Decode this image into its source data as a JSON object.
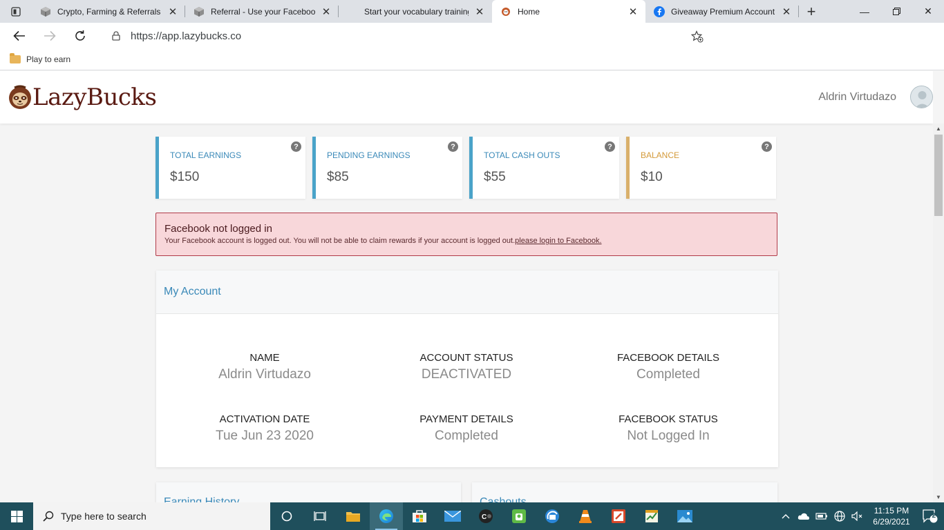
{
  "browser": {
    "tabs": [
      {
        "title": "Crypto, Farming & Referrals |",
        "icon": "box-icon"
      },
      {
        "title": "Referral - Use your Facebook",
        "icon": "box-icon"
      },
      {
        "title": "Start your vocabulary training",
        "icon": "blank-icon"
      },
      {
        "title": "Home",
        "icon": "lazybucks-icon"
      },
      {
        "title": "Giveaway Premium Account",
        "icon": "facebook-icon"
      }
    ],
    "url": "https://app.lazybucks.co",
    "bookmark_folder": "Play to earn"
  },
  "site": {
    "logo_text": "LazyBucks",
    "user_name": "Aldrin Virtudazo"
  },
  "stats": [
    {
      "label": "TOTAL EARNINGS",
      "value": "$150"
    },
    {
      "label": "PENDING EARNINGS",
      "value": "$85"
    },
    {
      "label": "TOTAL CASH OUTS",
      "value": "$55"
    },
    {
      "label": "BALANCE",
      "value": "$10"
    }
  ],
  "alert": {
    "title": "Facebook not logged in",
    "body": "Your Facebook account is logged out. You will not be able to claim rewards if your account is logged out.",
    "link": "please login to Facebook."
  },
  "account": {
    "title": "My Account",
    "fields": [
      {
        "key": "NAME",
        "value": "Aldrin Virtudazo"
      },
      {
        "key": "ACCOUNT STATUS",
        "value": "DEACTIVATED"
      },
      {
        "key": "FACEBOOK DETAILS",
        "value": "Completed"
      },
      {
        "key": "ACTIVATION DATE",
        "value": "Tue Jun 23 2020"
      },
      {
        "key": "PAYMENT DETAILS",
        "value": "Completed"
      },
      {
        "key": "FACEBOOK STATUS",
        "value": "Not Logged In"
      }
    ]
  },
  "sections": {
    "earning_history": "Earning History",
    "cashouts": "Cashouts"
  },
  "taskbar": {
    "search_placeholder": "Type here to search",
    "time": "11:15 PM",
    "date": "6/29/2021",
    "notifications": "2"
  },
  "colors": {
    "accent_blue": "#3a89b8",
    "balance_gold": "#d9b06b",
    "alert_bg": "#f8d7da",
    "brand": "#5a1a12"
  }
}
